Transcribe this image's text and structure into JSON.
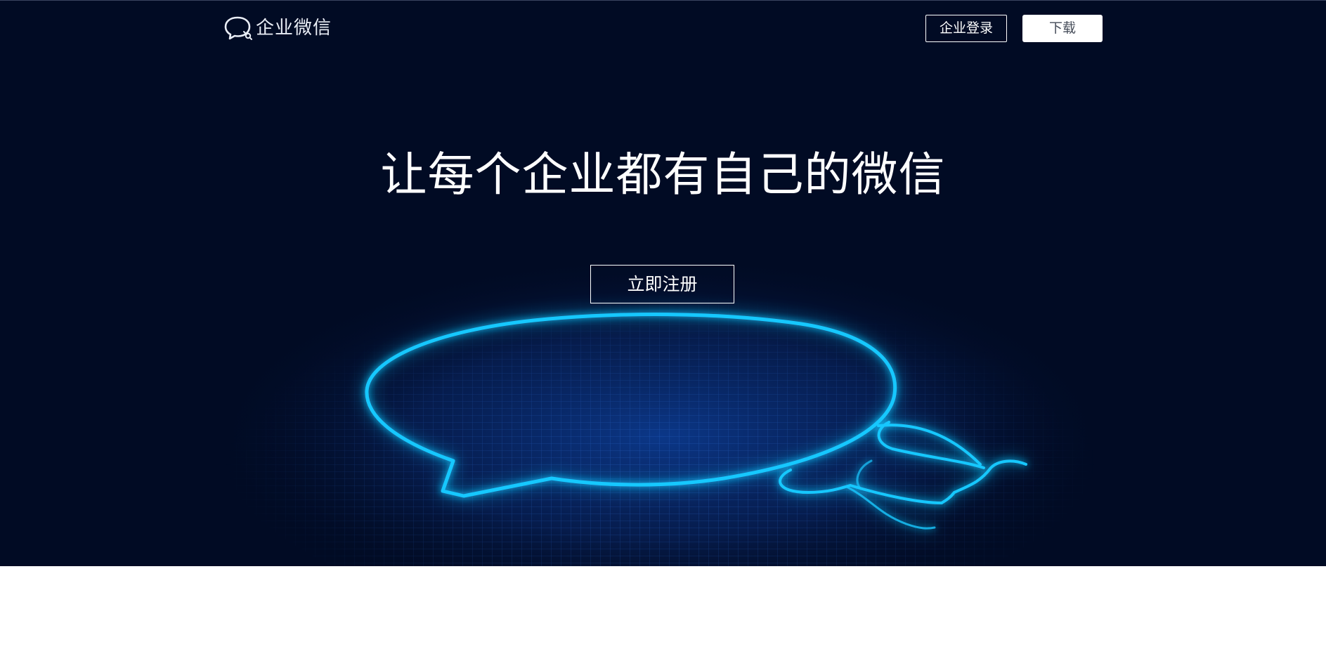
{
  "header": {
    "logo_text": "企业微信",
    "login_label": "企业登录",
    "download_label": "下载"
  },
  "hero": {
    "headline": "让每个企业都有自己的微信",
    "register_label": "立即注册"
  },
  "colors": {
    "hero_background": "#010b24",
    "glow_accent": "#19c8ff",
    "button_text_dark": "#444b58"
  },
  "icons": {
    "logo": "chat-bubble-logo-icon",
    "hero_art": "glowing-chat-bubble-illustration"
  }
}
